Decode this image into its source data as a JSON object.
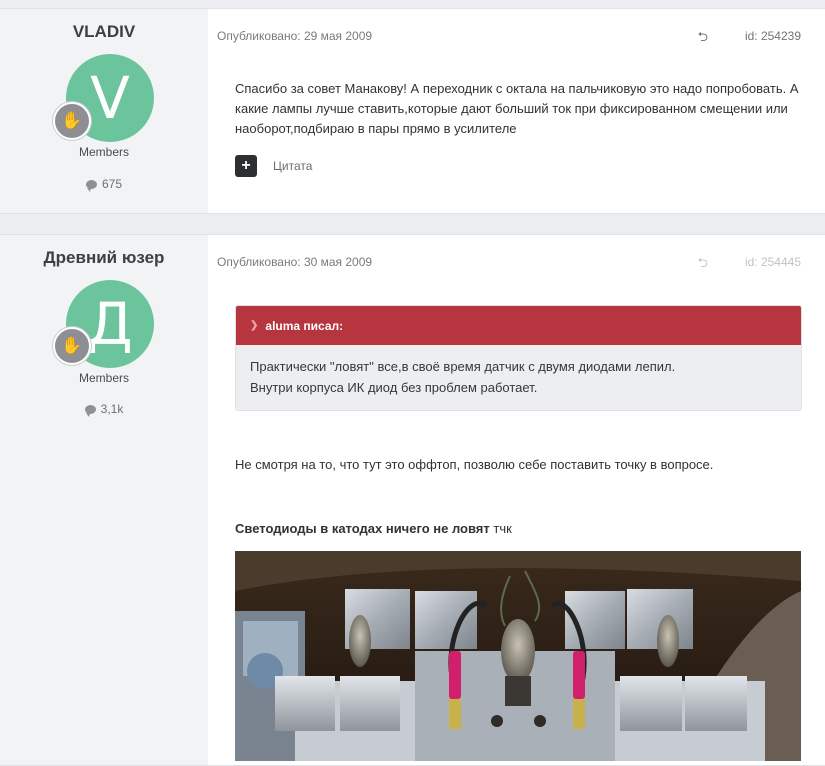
{
  "posts": [
    {
      "author": "VLADIV",
      "avatar_letter": "V",
      "avatar_color": "#6cc49c",
      "group": "Members",
      "post_count": "675",
      "date": "Опубликовано: 29 мая 2009",
      "id": "id: 254239",
      "text": "Спасибо за совет Манакову! А переходник с октала на пальчиковую это надо попробовать. А какие лампы лучше ставить,которые дают больший ток при фиксированном смещении или наоборот,подбираю в пары прямо в усилителе",
      "add_icon": "+",
      "quote_label": "Цитата"
    },
    {
      "author": "Древний юзер",
      "avatar_letter": "Д",
      "avatar_color": "#6cc49c",
      "group": "Members",
      "post_count": "3,1k",
      "date": "Опубликовано: 30 мая 2009",
      "id": "id: 254445",
      "quote_header": "aluma писал:",
      "quote_line1": "Практически \"ловят\" все,в своё время датчик с двумя диодами лепил.",
      "quote_line2": "Внутри корпуса ИК диод без проблем работает.",
      "paragraph1": "Не смотря на то, что тут это оффтоп, позволю себе поставить точку в вопросе.",
      "paragraph2_bold": "Светодиоды в катодах ничего не ловят",
      "paragraph2_rest": " тчк"
    }
  ],
  "icons": {
    "share": "share-icon",
    "comment": "comment-icon",
    "rank": "rank-badge-icon",
    "chevron": "chevron-down-icon"
  },
  "colors": {
    "quote_header": "#b6353f",
    "sidebar": "#f2f3f5",
    "page_bg": "#ebedf0"
  }
}
